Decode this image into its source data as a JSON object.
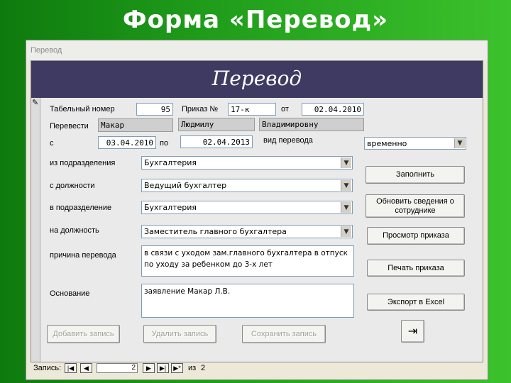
{
  "slide": {
    "title": "Форма «Перевод»"
  },
  "window": {
    "caption": "Перевод"
  },
  "form": {
    "header": "Перевод",
    "tab_number": {
      "label": "Табельный номер",
      "value": "95"
    },
    "order": {
      "label": "Приказ №",
      "value": "17-к",
      "date_label": "от",
      "date": "02.04.2010"
    },
    "transfer": {
      "label": "Перевести",
      "last_name": "Макар",
      "first_name": "Людмилу",
      "patronymic": "Владимировну"
    },
    "period": {
      "from_label": "с",
      "from": "03.04.2010",
      "to_label": "по",
      "to": "02.04.2013"
    },
    "transfer_type": {
      "label": "вид перевода",
      "value": "временно"
    },
    "from_dept": {
      "label": "из подразделения",
      "value": "Бухгалтерия"
    },
    "from_position": {
      "label": "с должности",
      "value": "Ведущий бухгалтер"
    },
    "to_dept": {
      "label": "в подразделение",
      "value": "Бухгалтерия"
    },
    "to_position": {
      "label": "на должность",
      "value": "Заместитель главного бухгалтера"
    },
    "reason": {
      "label": "причина перевода",
      "value": "в связи с уходом зам.главного бухгалтера в отпуск по уходу за ребенком до 3-х лет"
    },
    "basis": {
      "label": "Основание",
      "value": "заявление Макар Л.В."
    },
    "buttons": {
      "fill": "Заполнить",
      "update": "Обновить сведения о сотруднике",
      "view_order": "Просмотр приказа",
      "print_order": "Печать приказа",
      "export_excel": "Экспорт в Excel",
      "add_record": "Добавить запись",
      "delete_record": "Удалить запись",
      "save_record": "Сохранить запись"
    }
  },
  "navigation": {
    "label": "Запись:",
    "current": "2",
    "of_label": "из",
    "total": "2",
    "icons": {
      "first": "first-record-icon",
      "prev": "prev-record-icon",
      "next": "next-record-icon",
      "last": "last-record-icon",
      "new": "new-record-icon"
    }
  }
}
